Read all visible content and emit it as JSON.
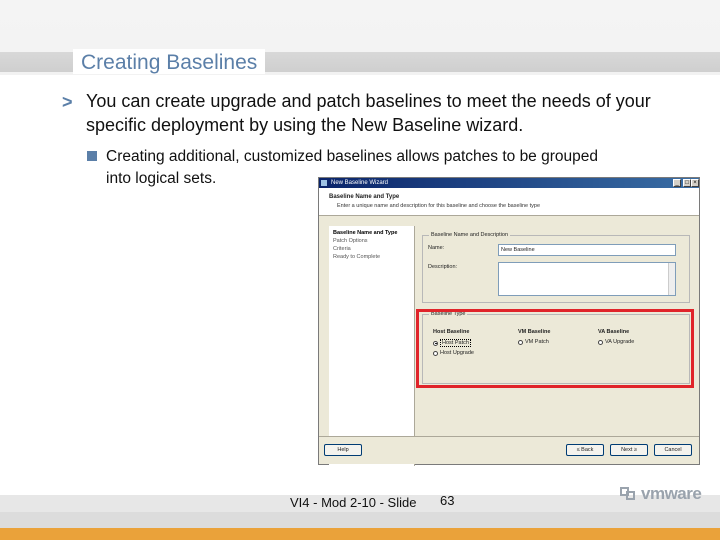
{
  "slide": {
    "title": "Creating Baselines",
    "bullet1": "You can create upgrade and patch baselines to meet the needs of your specific deployment by using the New Baseline wizard.",
    "bullet1_marker": ">",
    "bullet2": "Creating additional, customized baselines allows patches to be grouped into logical sets.",
    "footer_label": "VI4 - Mod 2-10 - Slide",
    "page_number": "63",
    "logo": {
      "icon": "vmware-logo-icon",
      "text": "vmware"
    },
    "colors": {
      "title": "#5b7fa8",
      "accent": "#eaa23a",
      "highlight": "#e0242a"
    }
  },
  "wizard": {
    "window_title": "New Baseline Wizard",
    "header_title": "Baseline Name and Type",
    "header_subtitle": "Enter a unique name and description for this baseline and choose the baseline type",
    "nav": [
      "Baseline Name and Type",
      "Patch Options",
      "Criteria",
      "Ready to Complete"
    ],
    "name_group": {
      "label": "Baseline Name and Description",
      "name_label": "Name:",
      "name_value": "New Baseline",
      "description_label": "Description:",
      "description_value": ""
    },
    "type_group": {
      "label": "Baseline Type",
      "host": {
        "title": "Host Baseline",
        "options": [
          "Host Patch",
          "Host Upgrade"
        ],
        "selected": "Host Patch"
      },
      "vm": {
        "title": "VM Baseline",
        "options": [
          "VM Patch"
        ]
      },
      "va": {
        "title": "VA Baseline",
        "options": [
          "VA Upgrade"
        ]
      }
    },
    "buttons": {
      "help": "Help",
      "back": "≤ Back",
      "next": "Next ≥",
      "cancel": "Cancel"
    }
  }
}
